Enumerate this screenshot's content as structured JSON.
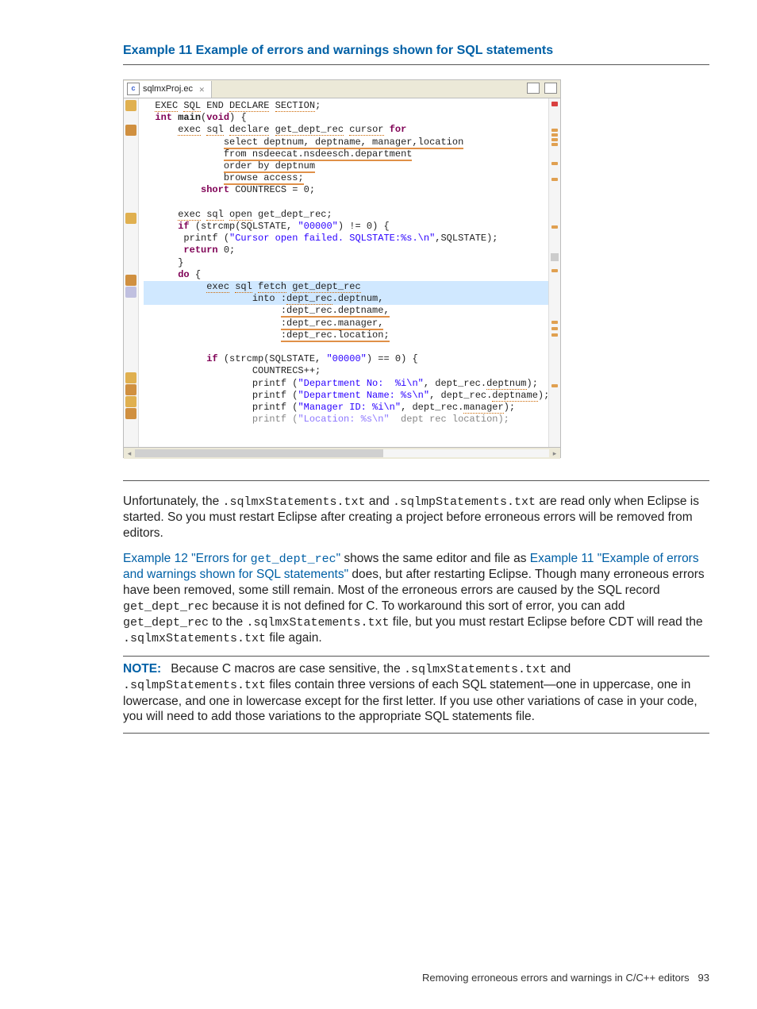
{
  "example_title": "Example 11 Example of errors and warnings shown for SQL statements",
  "editor": {
    "tab_name": "sqlmxProj.ec",
    "code_lines": [
      "  EXEC SQL END DECLARE SECTION;",
      "  int main(void) {",
      "      exec sql declare get_dept_rec cursor for",
      "              select deptnum, deptname, manager,location",
      "              from nsdeecat.nsdeesch.department",
      "              order by deptnum",
      "              browse access;",
      "          short COUNTRECS = 0;",
      "",
      "      exec sql open get_dept_rec;",
      "      if (strcmp(SQLSTATE, \"00000\") != 0) {",
      "       printf (\"Cursor open failed. SQLSTATE:%s.\\n\",SQLSTATE);",
      "       return 0;",
      "      }",
      "      do {",
      "           exec sql fetch get_dept_rec",
      "                   into :dept_rec.deptnum,",
      "                        :dept_rec.deptname,",
      "                        :dept_rec.manager,",
      "                        :dept_rec.location;",
      "",
      "           if (strcmp(SQLSTATE, \"00000\") == 0) {",
      "                   COUNTRECS++;",
      "                   printf (\"Department No:  %i\\n\", dept_rec.deptnum);",
      "                   printf (\"Department Name: %s\\n\", dept_rec.deptname);",
      "                   printf (\"Manager ID: %i\\n\", dept_rec.manager);",
      "                   printf (\"Location: %s\\n\"  dept rec location);"
    ]
  },
  "para1_a": "Unfortunately, the ",
  "para1_m1": ".sqlmxStatements.txt",
  "para1_b": " and ",
  "para1_m2": ".sqlmpStatements.txt",
  "para1_c": " are read only when Eclipse is started. So you must restart Eclipse after creating a project before erroneous errors will be removed from editors.",
  "para2_link1_a": "Example 12 \"Errors for ",
  "para2_link1_m": "get_dept_rec",
  "para2_link1_b": "\"",
  "para2_b": " shows the same editor and file as ",
  "para2_link2": "Example 11 \"Example of errors and warnings shown for SQL statements\"",
  "para2_c": " does, but after restarting Eclipse. Though many erroneous errors have been removed, some still remain. Most of the erroneous errors are caused by the SQL record ",
  "para2_m1": "get_dept_rec",
  "para2_d": " because it is not defined for C. To workaround this sort of error, you can add ",
  "para2_m2": "get_dept_rec",
  "para2_e": " to the ",
  "para2_m3": ".sqlmxStatements.txt",
  "para2_f": " file, but you must restart Eclipse before CDT will read the ",
  "para2_m4": ".sqlmxStatements.txt",
  "para2_g": " file again.",
  "note_label": "NOTE:",
  "note_a": "Because C macros are case sensitive, the ",
  "note_m1": ".sqlmxStatements.txt",
  "note_b": " and ",
  "note_m2": ".sqlmpStatements.txt",
  "note_c": " files contain three versions of each SQL statement—one in uppercase, one in lowercase, and one in lowercase except for the first letter. If you use other variations of case in your code, you will need to add those variations to the appropriate SQL statements file.",
  "footer_text": "Removing erroneous errors and warnings in C/C++ editors",
  "page_number": "93"
}
